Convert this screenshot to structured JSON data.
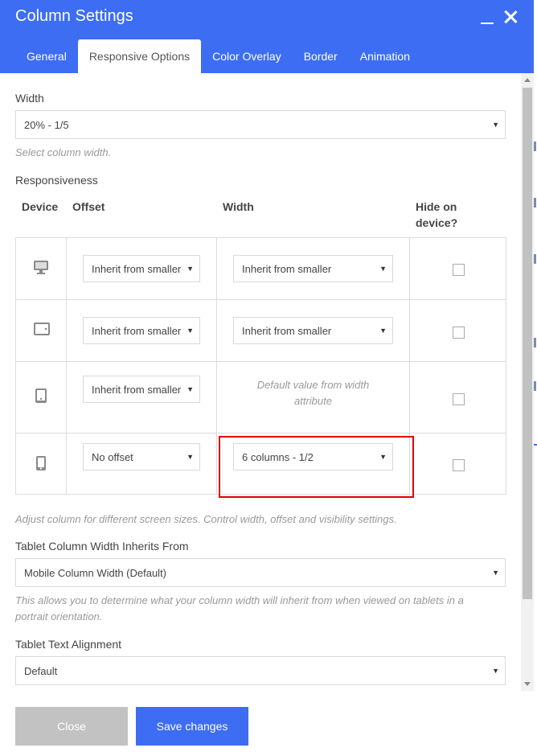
{
  "window": {
    "title": "Column Settings"
  },
  "tabs": [
    {
      "label": "General",
      "active": false
    },
    {
      "label": "Responsive Options",
      "active": true
    },
    {
      "label": "Color Overlay",
      "active": false
    },
    {
      "label": "Border",
      "active": false
    },
    {
      "label": "Animation",
      "active": false
    }
  ],
  "width_field": {
    "label": "Width",
    "value": "20% - 1/5",
    "help": "Select column width."
  },
  "responsiveness": {
    "label": "Responsiveness",
    "headers": {
      "device": "Device",
      "offset": "Offset",
      "width": "Width",
      "hide_line1": "Hide on",
      "hide_line2": "device?"
    },
    "rows": [
      {
        "device_icon": "desktop-icon",
        "offset": "Inherit from smaller",
        "width": "Inherit from smaller",
        "hidden": false
      },
      {
        "device_icon": "tablet-landscape-icon",
        "offset": "Inherit from smaller",
        "width": "Inherit from smaller",
        "hidden": false
      },
      {
        "device_icon": "tablet-portrait-icon",
        "offset": "Inherit from smaller",
        "width_note_line1": "Default value from width",
        "width_note_line2": "attribute",
        "hidden": false
      },
      {
        "device_icon": "mobile-icon",
        "offset": "No offset",
        "width": "6 columns - 1/2",
        "hidden": false
      }
    ],
    "help": "Adjust column for different screen sizes. Control width, offset and visibility settings."
  },
  "tablet_inherit": {
    "label": "Tablet Column Width Inherits From",
    "value": "Mobile Column Width (Default)",
    "help_line1": "This allows you to determine what your column width will inherit from when viewed on tablets in a",
    "help_line2": "portrait orientation."
  },
  "tablet_align": {
    "label": "Tablet Text Alignment",
    "value": "Default"
  },
  "footer": {
    "close_label": "Close",
    "save_label": "Save changes"
  },
  "colors": {
    "accent": "#3d6df2",
    "close_button": "#c2c2c2",
    "highlight": "#e00000"
  }
}
